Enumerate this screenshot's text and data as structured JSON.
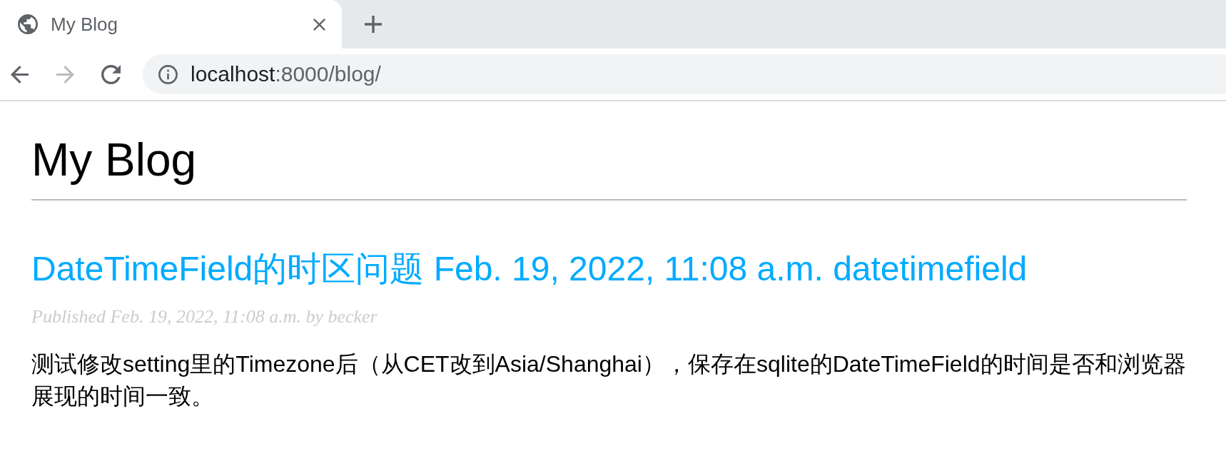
{
  "browser": {
    "tabs": [
      {
        "title": "My Blog",
        "selected": true
      }
    ],
    "nav": {
      "back_disabled": false,
      "forward_disabled": true
    },
    "address_bar": {
      "host": "localhost",
      "path": ":8000/blog/"
    }
  },
  "page": {
    "title": "My Blog",
    "posts": [
      {
        "title": "DateTimeField的时区问题 Feb. 19, 2022, 11:08 a.m. datetimefield",
        "byline": "Published Feb. 19, 2022, 11:08 a.m. by becker",
        "body": "测试修改setting里的Timezone后（从CET改到Asia/Shanghai），保存在sqlite的DateTimeField的时间是否和浏览器展现的时间一致。"
      }
    ]
  }
}
